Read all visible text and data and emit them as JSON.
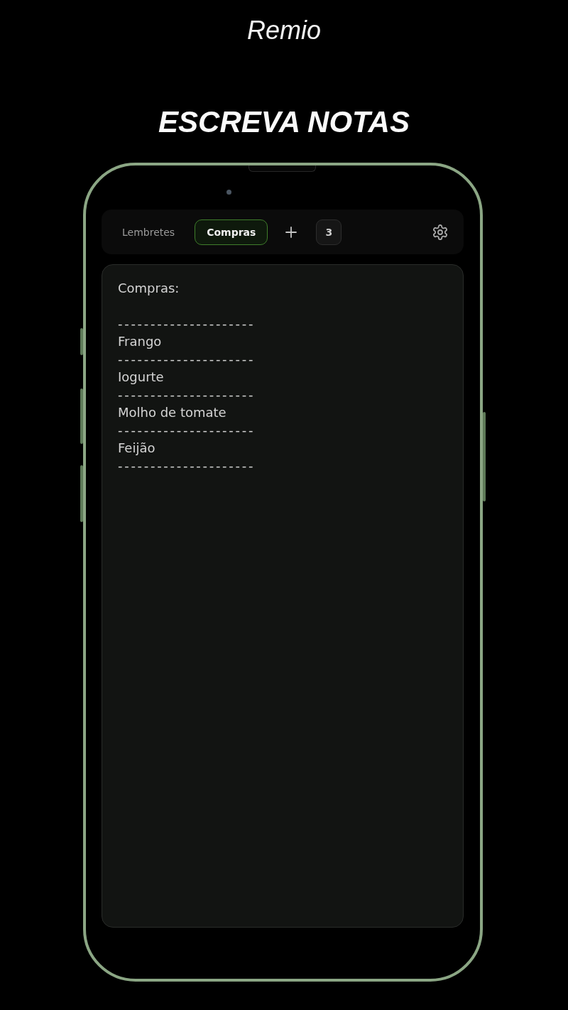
{
  "app_title": "Remio",
  "headline": "ESCREVA NOTAS",
  "tabs": [
    {
      "label": "Lembretes",
      "selected": false
    },
    {
      "label": "Compras",
      "selected": true
    }
  ],
  "tab_count": "3",
  "note": {
    "lines": [
      {
        "kind": "text",
        "text": "Compras:"
      },
      {
        "kind": "blank"
      },
      {
        "kind": "rule",
        "text": "---------------------"
      },
      {
        "kind": "text",
        "text": "Frango"
      },
      {
        "kind": "rule",
        "text": "---------------------"
      },
      {
        "kind": "text",
        "text": "Iogurte"
      },
      {
        "kind": "rule",
        "text": "---------------------"
      },
      {
        "kind": "text",
        "text": "Molho de tomate"
      },
      {
        "kind": "rule",
        "text": "---------------------"
      },
      {
        "kind": "text",
        "text": "Feijão"
      },
      {
        "kind": "rule",
        "text": "---------------------"
      }
    ]
  }
}
